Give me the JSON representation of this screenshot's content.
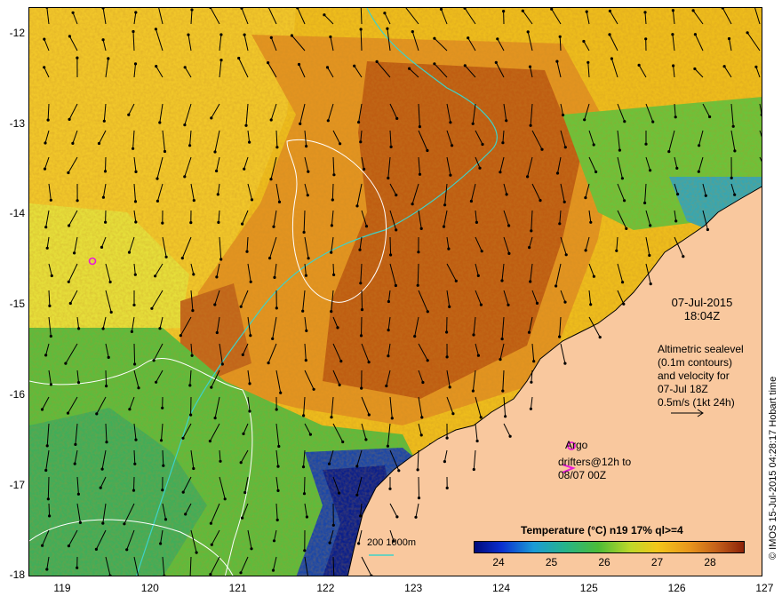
{
  "map": {
    "y_ticks": [
      "-12",
      "-13",
      "-14",
      "-15",
      "-16",
      "-17",
      "-18"
    ],
    "x_ticks": [
      "119",
      "120",
      "121",
      "122",
      "123",
      "124",
      "125",
      "126",
      "127"
    ],
    "colors": {
      "land": "#f9c89e",
      "cool_blue": "#0a1f8c",
      "green": "#49b73a",
      "yellow": "#f3c61a",
      "orange": "#e8951c",
      "brown": "#b5530f",
      "contour_white": "#ffffff",
      "bathy_cyan": "#3fd2c8",
      "argo_magenta": "#e81bd6"
    }
  },
  "annotations": {
    "date": "07-Jul-2015",
    "time": "18:04Z",
    "altimetry_lines": [
      "Altimetric sealevel",
      "(0.1m contours)",
      "and velocity for",
      "07-Jul 18Z",
      "0.5m/s (1kt 24h)"
    ],
    "argo_label": "Argo",
    "drifter_label_lines": [
      "drifters@12h to",
      "08/07 00Z"
    ],
    "bathy_legend": "200  1000m",
    "stamp": "© IMOS 15-Jul-2015 04:28:17 Hobart time"
  },
  "colorbar": {
    "title": "Temperature (°C) n19 17% ql>=4",
    "ticks": [
      "24",
      "25",
      "26",
      "27",
      "28"
    ]
  }
}
